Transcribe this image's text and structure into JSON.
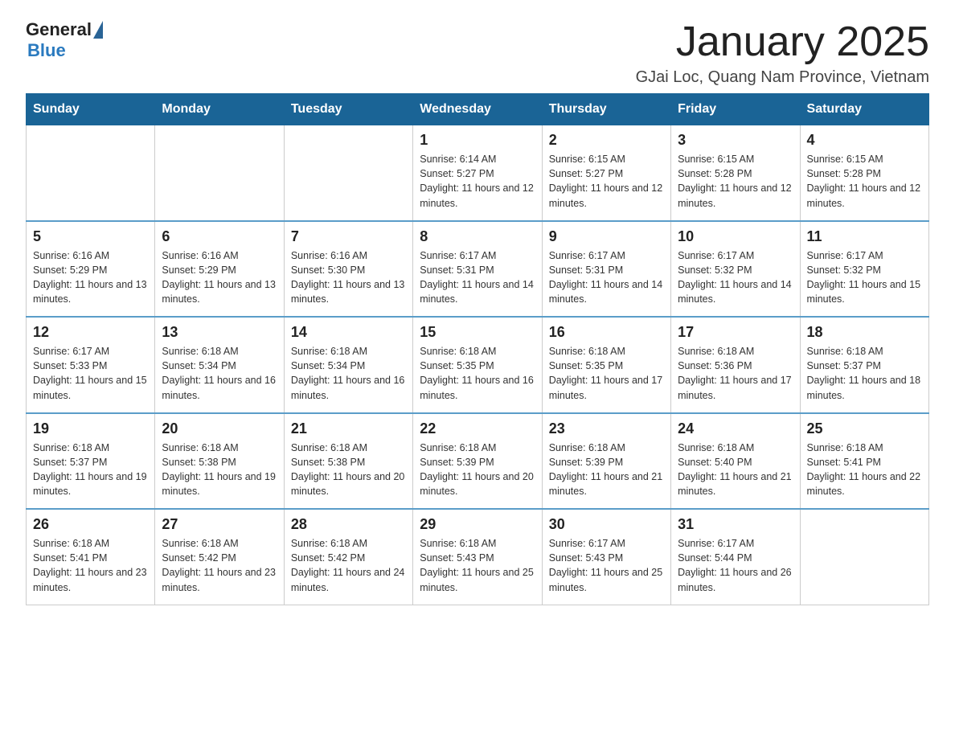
{
  "header": {
    "logo_general": "General",
    "logo_blue": "Blue",
    "title": "January 2025",
    "subtitle": "GJai Loc, Quang Nam Province, Vietnam"
  },
  "days_of_week": [
    "Sunday",
    "Monday",
    "Tuesday",
    "Wednesday",
    "Thursday",
    "Friday",
    "Saturday"
  ],
  "weeks": [
    {
      "days": [
        {
          "num": "",
          "info": ""
        },
        {
          "num": "",
          "info": ""
        },
        {
          "num": "",
          "info": ""
        },
        {
          "num": "1",
          "info": "Sunrise: 6:14 AM\nSunset: 5:27 PM\nDaylight: 11 hours and 12 minutes."
        },
        {
          "num": "2",
          "info": "Sunrise: 6:15 AM\nSunset: 5:27 PM\nDaylight: 11 hours and 12 minutes."
        },
        {
          "num": "3",
          "info": "Sunrise: 6:15 AM\nSunset: 5:28 PM\nDaylight: 11 hours and 12 minutes."
        },
        {
          "num": "4",
          "info": "Sunrise: 6:15 AM\nSunset: 5:28 PM\nDaylight: 11 hours and 12 minutes."
        }
      ]
    },
    {
      "days": [
        {
          "num": "5",
          "info": "Sunrise: 6:16 AM\nSunset: 5:29 PM\nDaylight: 11 hours and 13 minutes."
        },
        {
          "num": "6",
          "info": "Sunrise: 6:16 AM\nSunset: 5:29 PM\nDaylight: 11 hours and 13 minutes."
        },
        {
          "num": "7",
          "info": "Sunrise: 6:16 AM\nSunset: 5:30 PM\nDaylight: 11 hours and 13 minutes."
        },
        {
          "num": "8",
          "info": "Sunrise: 6:17 AM\nSunset: 5:31 PM\nDaylight: 11 hours and 14 minutes."
        },
        {
          "num": "9",
          "info": "Sunrise: 6:17 AM\nSunset: 5:31 PM\nDaylight: 11 hours and 14 minutes."
        },
        {
          "num": "10",
          "info": "Sunrise: 6:17 AM\nSunset: 5:32 PM\nDaylight: 11 hours and 14 minutes."
        },
        {
          "num": "11",
          "info": "Sunrise: 6:17 AM\nSunset: 5:32 PM\nDaylight: 11 hours and 15 minutes."
        }
      ]
    },
    {
      "days": [
        {
          "num": "12",
          "info": "Sunrise: 6:17 AM\nSunset: 5:33 PM\nDaylight: 11 hours and 15 minutes."
        },
        {
          "num": "13",
          "info": "Sunrise: 6:18 AM\nSunset: 5:34 PM\nDaylight: 11 hours and 16 minutes."
        },
        {
          "num": "14",
          "info": "Sunrise: 6:18 AM\nSunset: 5:34 PM\nDaylight: 11 hours and 16 minutes."
        },
        {
          "num": "15",
          "info": "Sunrise: 6:18 AM\nSunset: 5:35 PM\nDaylight: 11 hours and 16 minutes."
        },
        {
          "num": "16",
          "info": "Sunrise: 6:18 AM\nSunset: 5:35 PM\nDaylight: 11 hours and 17 minutes."
        },
        {
          "num": "17",
          "info": "Sunrise: 6:18 AM\nSunset: 5:36 PM\nDaylight: 11 hours and 17 minutes."
        },
        {
          "num": "18",
          "info": "Sunrise: 6:18 AM\nSunset: 5:37 PM\nDaylight: 11 hours and 18 minutes."
        }
      ]
    },
    {
      "days": [
        {
          "num": "19",
          "info": "Sunrise: 6:18 AM\nSunset: 5:37 PM\nDaylight: 11 hours and 19 minutes."
        },
        {
          "num": "20",
          "info": "Sunrise: 6:18 AM\nSunset: 5:38 PM\nDaylight: 11 hours and 19 minutes."
        },
        {
          "num": "21",
          "info": "Sunrise: 6:18 AM\nSunset: 5:38 PM\nDaylight: 11 hours and 20 minutes."
        },
        {
          "num": "22",
          "info": "Sunrise: 6:18 AM\nSunset: 5:39 PM\nDaylight: 11 hours and 20 minutes."
        },
        {
          "num": "23",
          "info": "Sunrise: 6:18 AM\nSunset: 5:39 PM\nDaylight: 11 hours and 21 minutes."
        },
        {
          "num": "24",
          "info": "Sunrise: 6:18 AM\nSunset: 5:40 PM\nDaylight: 11 hours and 21 minutes."
        },
        {
          "num": "25",
          "info": "Sunrise: 6:18 AM\nSunset: 5:41 PM\nDaylight: 11 hours and 22 minutes."
        }
      ]
    },
    {
      "days": [
        {
          "num": "26",
          "info": "Sunrise: 6:18 AM\nSunset: 5:41 PM\nDaylight: 11 hours and 23 minutes."
        },
        {
          "num": "27",
          "info": "Sunrise: 6:18 AM\nSunset: 5:42 PM\nDaylight: 11 hours and 23 minutes."
        },
        {
          "num": "28",
          "info": "Sunrise: 6:18 AM\nSunset: 5:42 PM\nDaylight: 11 hours and 24 minutes."
        },
        {
          "num": "29",
          "info": "Sunrise: 6:18 AM\nSunset: 5:43 PM\nDaylight: 11 hours and 25 minutes."
        },
        {
          "num": "30",
          "info": "Sunrise: 6:17 AM\nSunset: 5:43 PM\nDaylight: 11 hours and 25 minutes."
        },
        {
          "num": "31",
          "info": "Sunrise: 6:17 AM\nSunset: 5:44 PM\nDaylight: 11 hours and 26 minutes."
        },
        {
          "num": "",
          "info": ""
        }
      ]
    }
  ]
}
